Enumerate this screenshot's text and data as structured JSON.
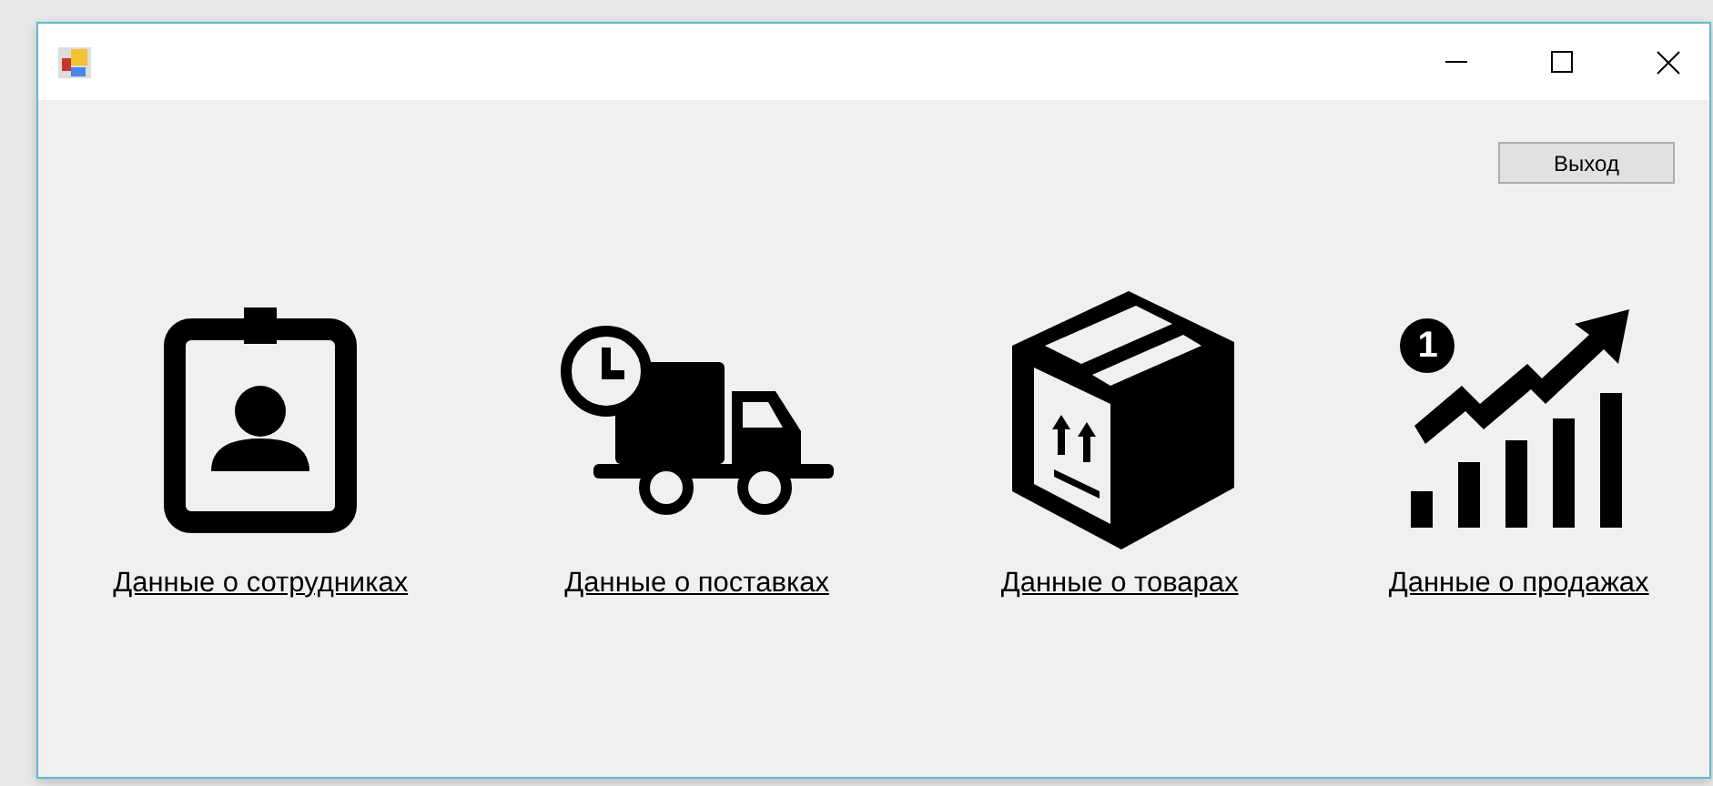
{
  "exit_button": "Выход",
  "links": [
    {
      "kind": "badge",
      "label": "Данные о сотрудниках"
    },
    {
      "kind": "truck",
      "label": "Данные о поставках"
    },
    {
      "kind": "box",
      "label": "Данные о товарах"
    },
    {
      "kind": "chart",
      "label": "Данные о продажах",
      "marker": "1"
    }
  ]
}
